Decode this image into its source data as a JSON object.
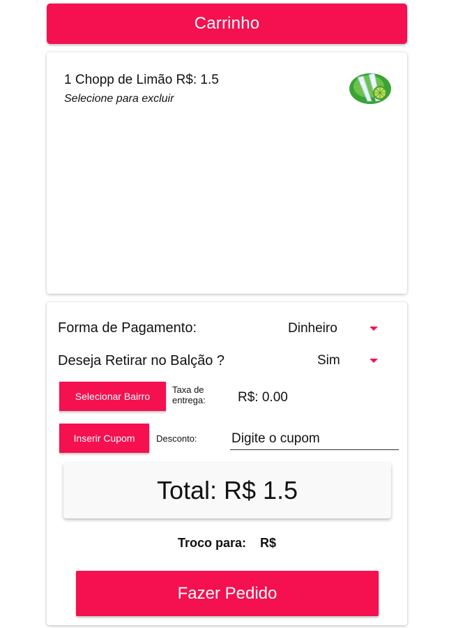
{
  "header": {
    "title": "Carrinho"
  },
  "cart": {
    "items": [
      {
        "label": "1 Chopp de Limão R$: 1.5",
        "hint": "Selecione para excluir",
        "image_icon": "lime-drink-icon"
      }
    ]
  },
  "order": {
    "payment": {
      "label": "Forma de Pagamento:",
      "value": "Dinheiro"
    },
    "pickup": {
      "label": "Deseja Retirar no Balção ?",
      "value": "Sim"
    },
    "neighborhood_button": "Selecionar Bairro",
    "delivery_fee_label": "Taxa de entrega:",
    "delivery_fee_value": "R$: 0.00",
    "coupon_button": "Inserir Cupom",
    "discount_label": "Desconto:",
    "coupon_placeholder": "Digite o cupom",
    "total": "Total: R$ 1.5",
    "change_label": "Troco para:",
    "change_currency": "R$",
    "submit_button": "Fazer Pedido"
  },
  "colors": {
    "accent": "#F5104F",
    "background": "#FFFFFF"
  }
}
